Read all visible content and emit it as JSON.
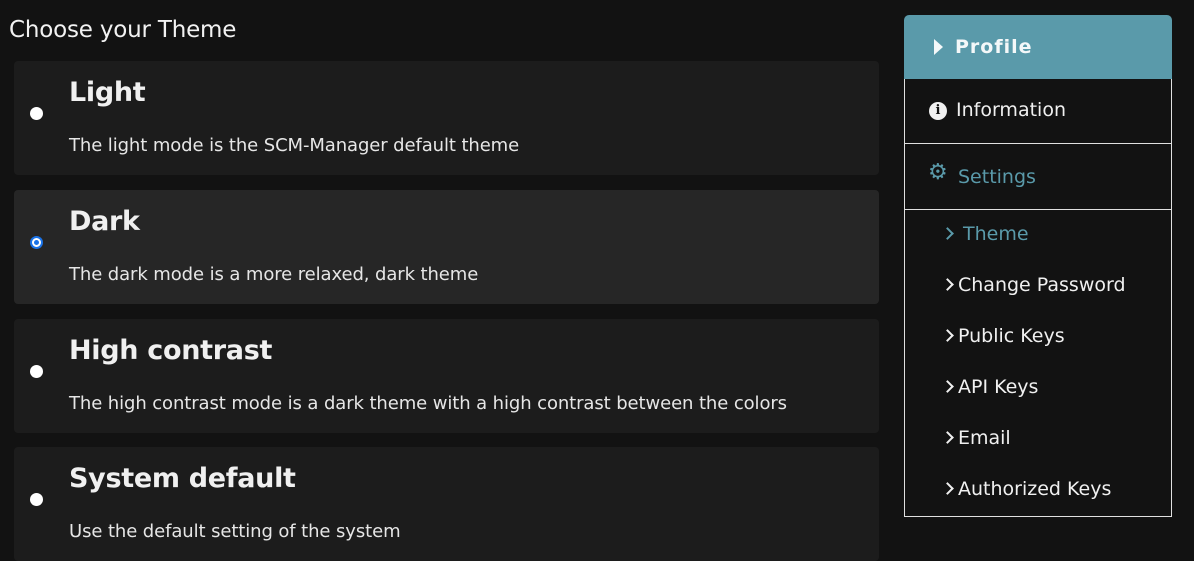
{
  "heading": "Choose your Theme",
  "options": [
    {
      "title": "Light",
      "description": "The light mode is the SCM-Manager default theme",
      "selected": false
    },
    {
      "title": "Dark",
      "description": "The dark mode is a more relaxed, dark theme",
      "selected": true
    },
    {
      "title": "High contrast",
      "description": "The high contrast mode is a dark theme with a high contrast between the colors",
      "selected": false
    },
    {
      "title": "System default",
      "description": "Use the default setting of the system",
      "selected": false
    }
  ],
  "sidebar": {
    "header": "Profile",
    "items": [
      {
        "label": "Information",
        "icon": "info-circle-icon"
      },
      {
        "label": "Settings",
        "icon": "gear-icon"
      }
    ],
    "subitems": [
      {
        "label": "Theme",
        "active": true
      },
      {
        "label": "Change Password",
        "active": false
      },
      {
        "label": "Public Keys",
        "active": false
      },
      {
        "label": "API Keys",
        "active": false
      },
      {
        "label": "Email",
        "active": false
      },
      {
        "label": "Authorized Keys",
        "active": false
      }
    ]
  },
  "colors": {
    "accent": "#5a9aaa",
    "radio_selected": "#1a73e8",
    "background": "#121212",
    "card": "#1c1c1c",
    "card_selected": "#262626"
  }
}
